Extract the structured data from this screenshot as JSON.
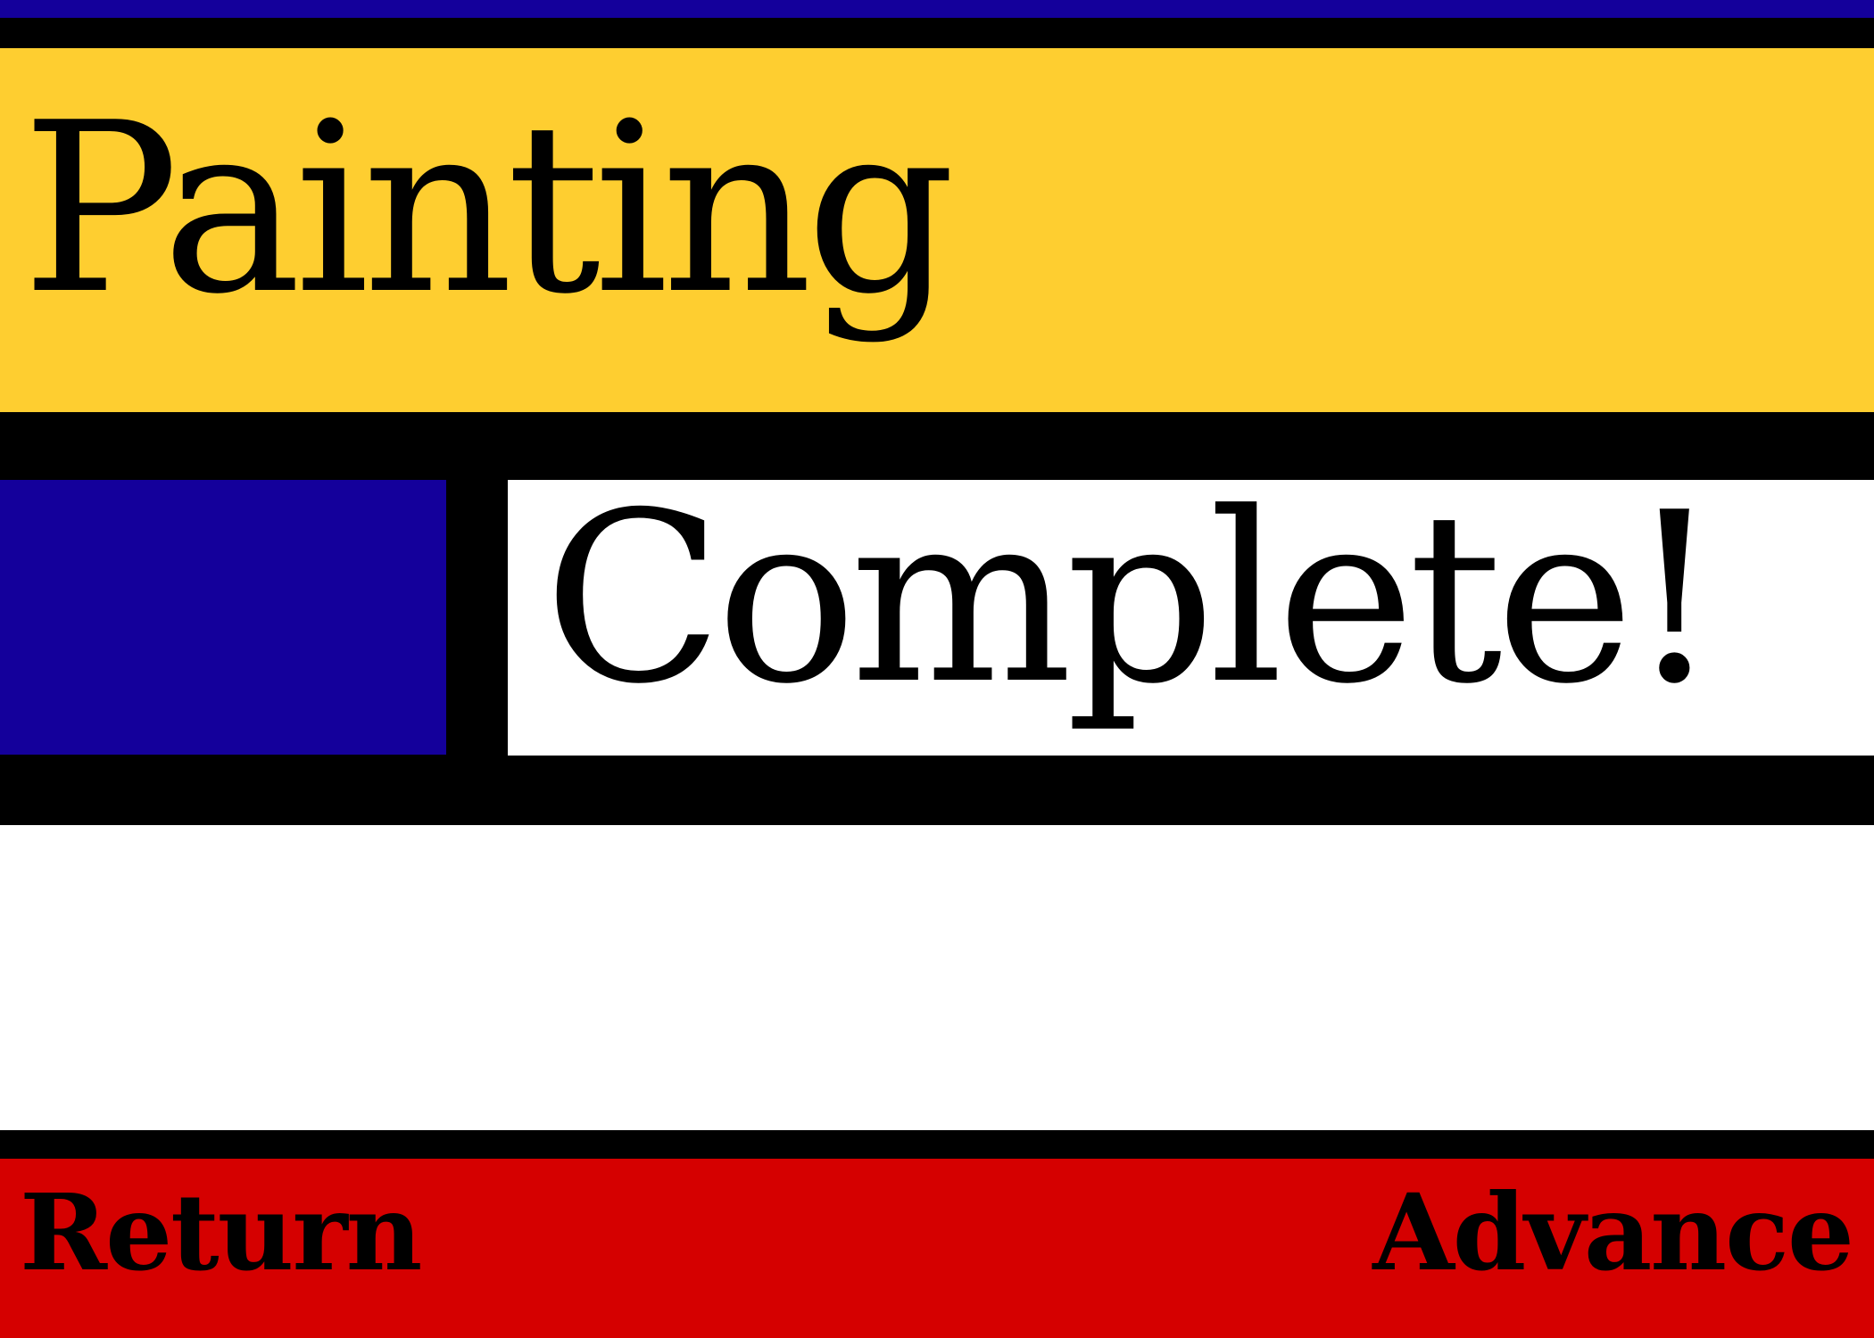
{
  "screen": {
    "title_line_1": "Painting",
    "title_line_2": "Complete!"
  },
  "menu": {
    "return_label": "Return",
    "advance_label": "Advance"
  },
  "palette": {
    "blue": "#14009B",
    "yellow": "#FECE30",
    "red": "#D50000",
    "white": "#FFFFFF",
    "black": "#000000"
  }
}
